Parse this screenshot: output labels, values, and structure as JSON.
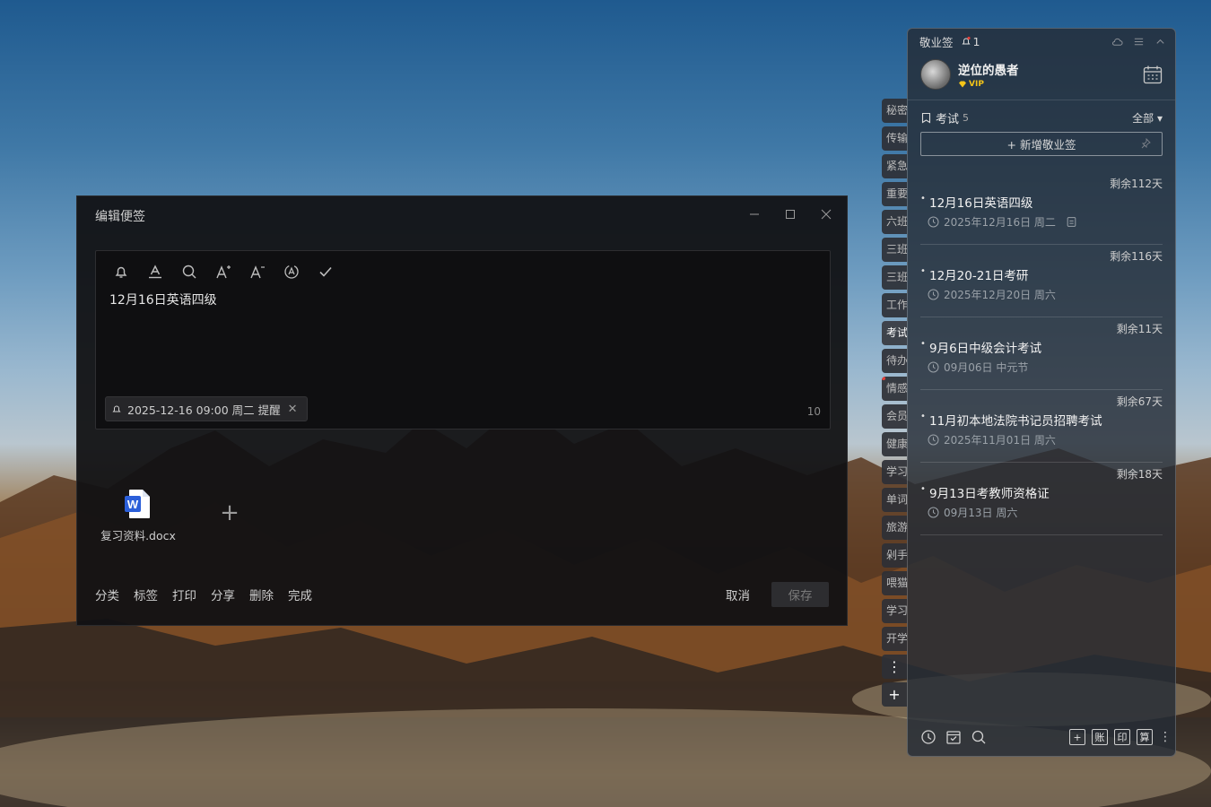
{
  "editor": {
    "title": "编辑便签",
    "content": "12月16日英语四级",
    "reminder": "2025-12-16 09:00 周二 提醒",
    "char_count": "10",
    "attachment": "复习资料.docx",
    "doc_badge": "W",
    "actions": [
      "分类",
      "标签",
      "打印",
      "分享",
      "删除",
      "完成"
    ],
    "cancel": "取消",
    "save": "保存"
  },
  "side_tabs": [
    "秘密",
    "传输",
    "紧急",
    "重要",
    "六班",
    "三班",
    "三班",
    "工作",
    "考试",
    "待办",
    "情感",
    "会员",
    "健康",
    "学习",
    "单词",
    "旅游",
    "剁手",
    "喂猫",
    "学习",
    "开学"
  ],
  "side_tab_more": "⋮",
  "side_tab_add": "+",
  "panel": {
    "app_name": "敬业签",
    "notif_count": "1",
    "username": "逆位的愚者",
    "vip": "VIP",
    "category": "考试",
    "category_count": "5",
    "filter": "全部 ▾",
    "new_note": "+ 新增敬业签",
    "notes": [
      {
        "remain": "剩余112天",
        "title": "12月16日英语四级",
        "date": "2025年12月16日 周二"
      },
      {
        "remain": "剩余116天",
        "title": "12月20-21日考研",
        "date": "2025年12月20日 周六"
      },
      {
        "remain": "剩余11天",
        "title": "9月6日中级会计考试",
        "date": "09月06日 中元节"
      },
      {
        "remain": "剩余67天",
        "title": "11月初本地法院书记员招聘考试",
        "date": "2025年11月01日 周六"
      },
      {
        "remain": "剩余18天",
        "title": "9月13日考教师资格证",
        "date": "09月13日 周六"
      }
    ],
    "bottom_buttons": [
      "+",
      "账",
      "印",
      "算"
    ],
    "bullet": "•"
  }
}
